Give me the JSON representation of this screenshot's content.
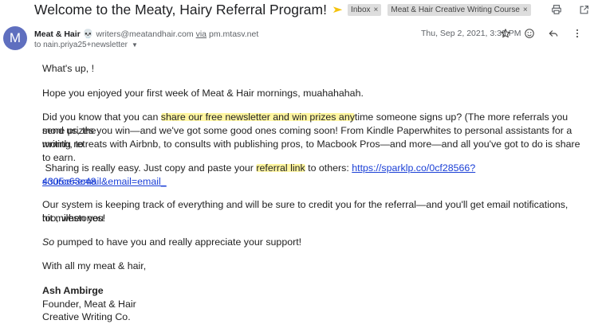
{
  "header": {
    "subject": "Welcome to the Meaty, Hairy Referral Program!",
    "labels": [
      {
        "text": "Inbox",
        "remove": "×"
      },
      {
        "text": "Meat & Hair Creative Writing Course",
        "remove": "×"
      }
    ],
    "toolbar_icons": [
      "print-icon",
      "open-in-new-window-icon"
    ]
  },
  "message": {
    "avatar_letter": "M",
    "sender_name": "Meat & Hair",
    "sender_email": "writers@meatandhair.com",
    "via_label": "via",
    "via_domain": "pm.mtasv.net",
    "recipient": "to nain.priya25+newsletter",
    "date": "Thu, Sep 2, 2021, 3:39 PM",
    "action_icons": [
      "star-icon",
      "emoji-reaction-icon",
      "reply-icon",
      "more-options-icon"
    ]
  },
  "body": {
    "greeting": "What's up, !",
    "p1": "Hope you enjoyed your first week of Meat & Hair mornings, muahahahah.",
    "p2_before": "Did you know that you can ",
    "p2_highlight": "share our free newsletter and win prizes any",
    "p2_after": "time someone signs up? (The more referrals you send us, the",
    "p2_line2": "more prizes you win—and we've got some good ones coming soon! From Kindle Paperwhites to personal assistants for a month, to",
    "p2_line3": "writing retreats with Airbnb, to consults with publishing pros, to Macbook Pros—and more—and all you've got to do is share to earn.",
    "p3_before": " Sharing is really easy. Just copy and paste your ",
    "p3_highlight": "referral link",
    "p3_after": " to others: ",
    "p3_link_line1": "https://sparklp.co/0cf28566?source=email&email=email_",
    "p3_link_line2": "4305c63c48",
    "p4_line1": "Our system is keeping track of everything and will be sure to credit you for the referral—and you'll get email notifications, too, when you",
    "p4_line2": "hit milestones!",
    "p5_italic": "So",
    "p5_rest": " pumped to have you and really appreciate your support!",
    "signoff": "With all my meat & hair,",
    "sig_name": "Ash Ambirge",
    "sig_title": "Founder, Meat & Hair",
    "sig_org": "Creative Writing Co."
  }
}
